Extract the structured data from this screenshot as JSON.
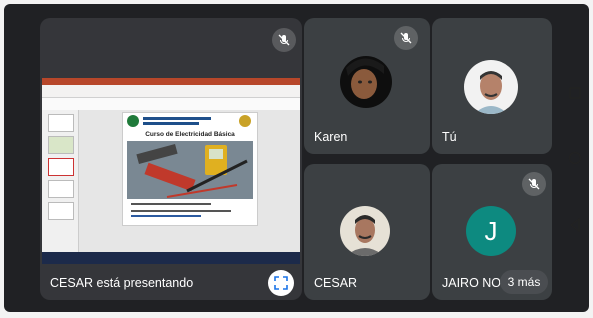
{
  "presenter": {
    "label": "CESAR está presentando"
  },
  "slide": {
    "title": "Curso de Electricidad Básica"
  },
  "participants": [
    {
      "name": "Karen"
    },
    {
      "name": "Tú"
    },
    {
      "name": "CESAR"
    },
    {
      "name": "JAIRO NOR",
      "initial": "J"
    }
  ],
  "more": {
    "label": "3 más"
  },
  "colors": {
    "jairo_avatar": "#0d8a80",
    "tile": "#3c4043",
    "background": "#202124"
  }
}
